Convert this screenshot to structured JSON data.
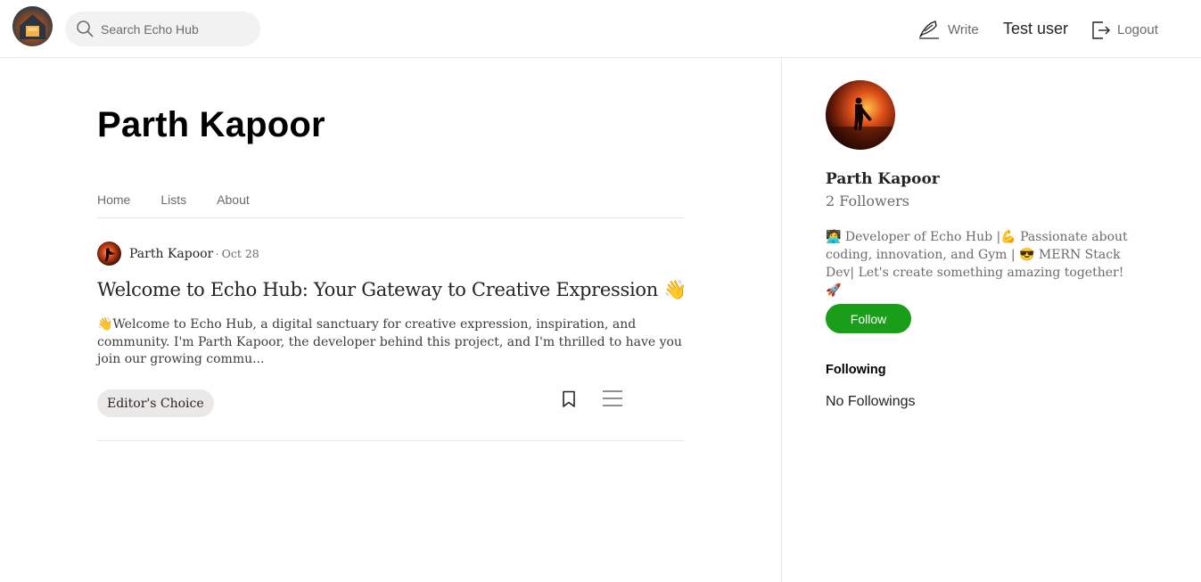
{
  "header": {
    "logo_icon": "echo-hub-logo",
    "search_placeholder": "Search Echo Hub",
    "write_label": "Write",
    "user_name": "Test user",
    "logout_label": "Logout"
  },
  "profile": {
    "name": "Parth Kapoor",
    "tabs": [
      {
        "label": "Home"
      },
      {
        "label": "Lists"
      },
      {
        "label": "About"
      }
    ]
  },
  "post": {
    "author": "Parth Kapoor",
    "separator": "·",
    "date": "Oct 28",
    "title": "Welcome to Echo Hub: Your Gateway to Creative Expression 👋",
    "excerpt": "👋Welcome to Echo Hub, a digital sanctuary for creative expression, inspiration, and community. I'm Parth Kapoor, the developer behind this project, and I'm thrilled to have you join our growing commu...",
    "tag": "Editor's Choice"
  },
  "sidebar": {
    "name": "Parth Kapoor",
    "followers": "2 Followers",
    "bio": "🧑‍💻 Developer of Echo Hub |💪 Passionate about coding, innovation, and Gym | 😎 MERN Stack Dev| Let's create something amazing together! 🚀",
    "follow_label": "Follow",
    "following_heading": "Following",
    "no_following_text": "No Followings"
  },
  "colors": {
    "follow_button": "#1a9e1a",
    "divider": "#e6e6e6",
    "tag_background": "#ebe8e8"
  }
}
